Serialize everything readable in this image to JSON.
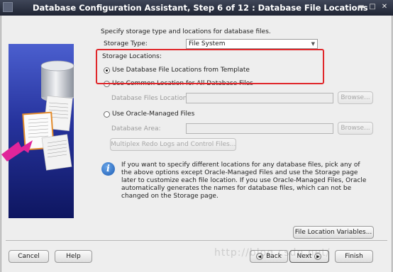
{
  "window": {
    "title": "Database Configuration Assistant, Step 6 of 12 : Database File Locations"
  },
  "intro": "Specify storage type and locations for database files.",
  "storage_type": {
    "label": "Storage Type:",
    "value": "File System"
  },
  "storage_locations": {
    "label": "Storage Locations:"
  },
  "options": {
    "template": "Use Database File Locations from Template",
    "common": "Use Common Location for All Database Files",
    "db_files_location_label": "Database Files Location:",
    "omf": "Use Oracle-Managed Files",
    "db_area_label": "Database Area:"
  },
  "buttons": {
    "browse": "Browse...",
    "multiplex": "Multiplex Redo Logs and Control Files...",
    "file_location_vars": "File Location Variables...",
    "cancel": "Cancel",
    "help": "Help",
    "back": "Back",
    "next": "Next",
    "finish": "Finish"
  },
  "info": "If you want to specify different locations for any database files, pick any of the above options except Oracle-Managed Files and use the Storage page later to customize each file location. If you use Oracle-Managed Files, Oracle automatically generates the names for database files, which can not be changed on the Storage page.",
  "watermark": "http://blog.csdn.net/",
  "colors": {
    "title_bar": "#2c3244",
    "highlight": "#e0262a",
    "art_top": "#4b5fcf",
    "art_bottom": "#0e1660"
  },
  "state": {
    "selected_option": "template"
  }
}
